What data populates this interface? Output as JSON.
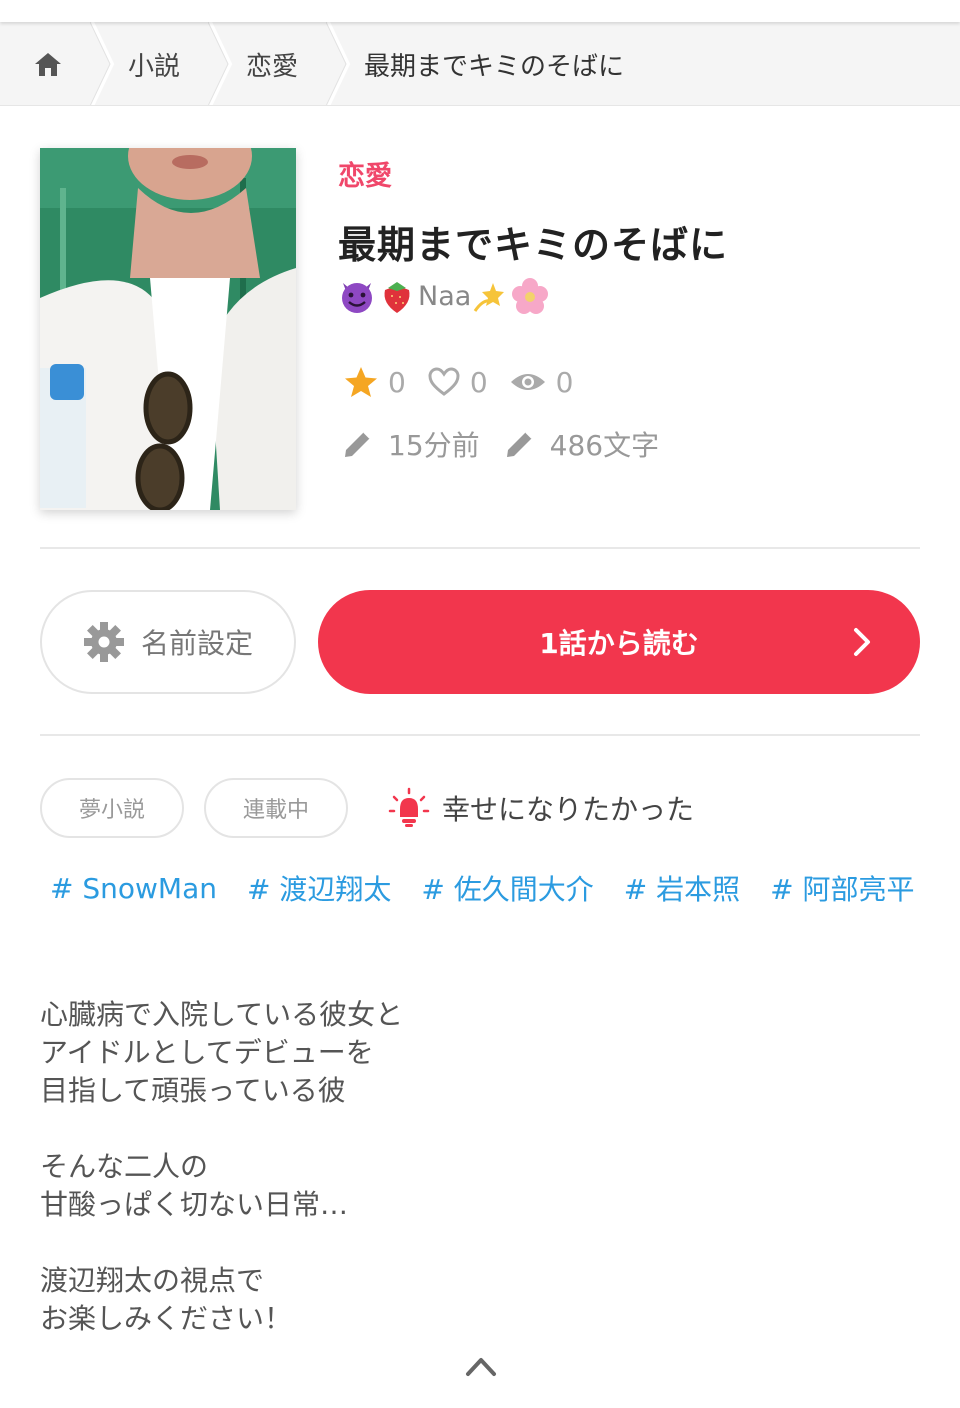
{
  "breadcrumb": {
    "home_icon": "home-icon",
    "items": [
      "小説",
      "恋愛",
      "最期までキミのそばに"
    ]
  },
  "story": {
    "genre": "恋愛",
    "title": "最期までキミのそばに",
    "author_emoji_prefix": [
      "smiling-devil-emoji",
      "strawberry-emoji"
    ],
    "author_name": "Naa",
    "author_emoji_suffix": [
      "dizzy-emoji",
      "cherry-blossom-emoji"
    ],
    "stars": "0",
    "likes": "0",
    "views": "0",
    "updated": "15分前",
    "chars": "486文字"
  },
  "actions": {
    "name_setting_label": "名前設定",
    "read_label": "1話から読む"
  },
  "tags": {
    "pills": [
      "夢小説",
      "連載中"
    ],
    "mood": "幸せになりたかった",
    "hashtags": [
      "# SnowMan",
      "# 渡辺翔太",
      "# 佐久間大介",
      "# 岩本照",
      "# 阿部亮平"
    ]
  },
  "description": {
    "lines": [
      "心臓病で入院している彼女と",
      "アイドルとしてデビューを",
      "目指して頑張っている彼",
      "",
      "そんな二人の",
      "甘酸っぱく切ない日常…",
      "",
      "渡辺翔太の視点で",
      "お楽しみください！"
    ]
  },
  "colors": {
    "accent": "#f2364d",
    "genre": "#f0476a",
    "hashtag": "#2b9be0",
    "star": "#f5a623"
  }
}
